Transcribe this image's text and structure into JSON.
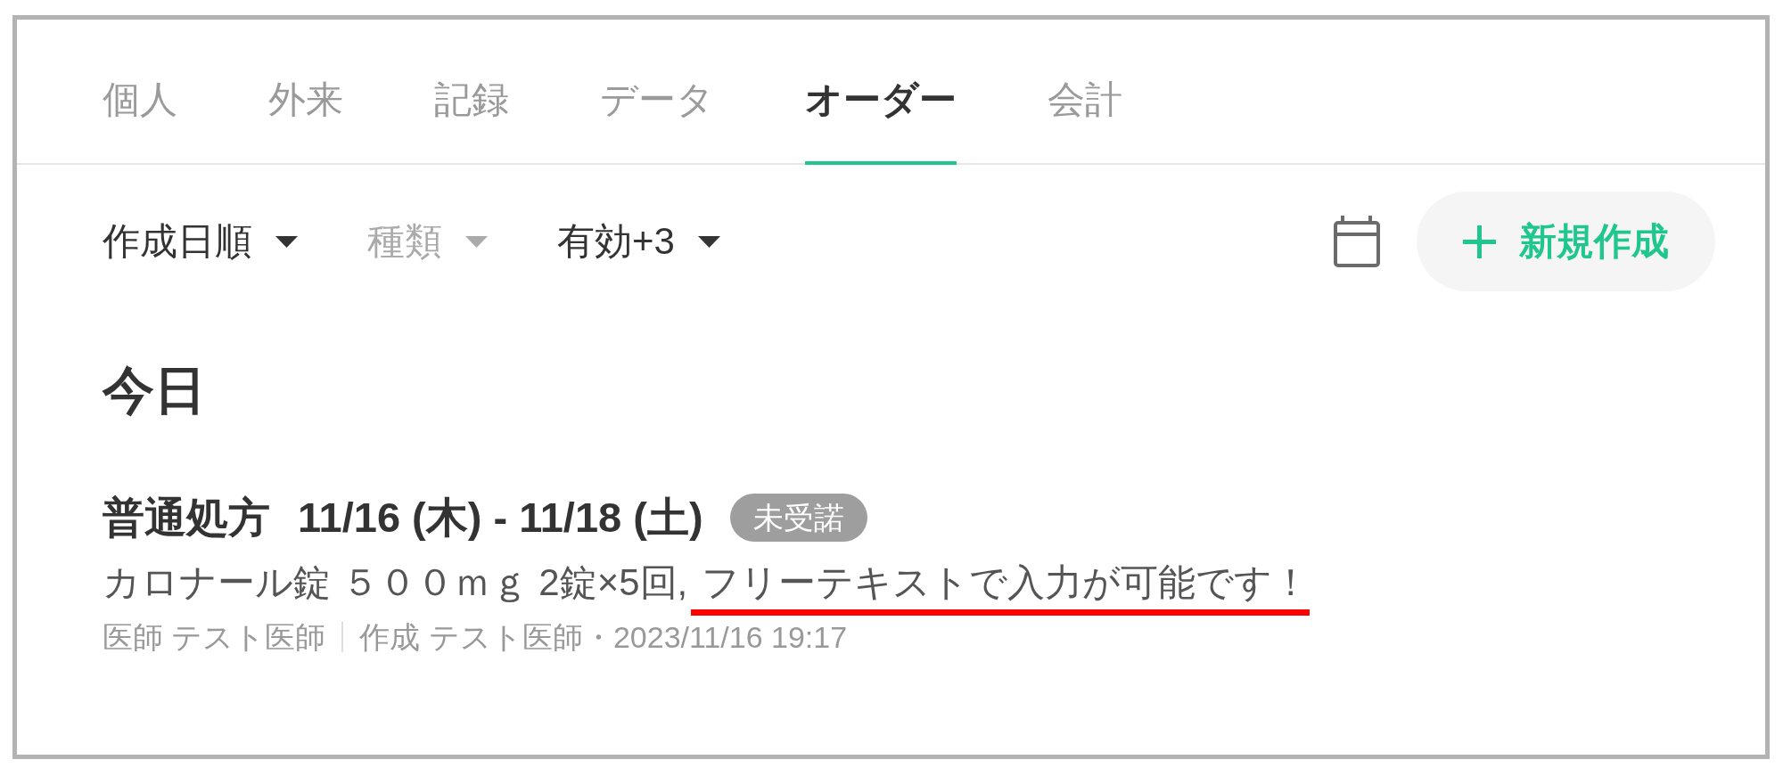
{
  "tabs": [
    {
      "label": "個人",
      "selected": false
    },
    {
      "label": "外来",
      "selected": false
    },
    {
      "label": "記録",
      "selected": false
    },
    {
      "label": "データ",
      "selected": false
    },
    {
      "label": "オーダー",
      "selected": true
    },
    {
      "label": "会計",
      "selected": false
    }
  ],
  "toolbar": {
    "filters": [
      {
        "label": "作成日順",
        "disabled": false
      },
      {
        "label": "種類",
        "disabled": true
      },
      {
        "label": "有効+3",
        "disabled": false
      }
    ],
    "new_button": {
      "label": "新規作成"
    }
  },
  "sections": [
    {
      "heading": "今日",
      "orders": [
        {
          "type": "普通処方",
          "period": "11/16 (木) - 11/18 (土)",
          "status": "未受諾",
          "medication": "カロナール錠 ５００ｍｇ 2錠×5回,",
          "free_text": {
            "text": "フリーテキストで入力が可能です！",
            "underlined": true
          },
          "doctor": "医師 テスト医師",
          "created": "作成 テスト医師・2023/11/16 19:17"
        }
      ]
    }
  ]
}
